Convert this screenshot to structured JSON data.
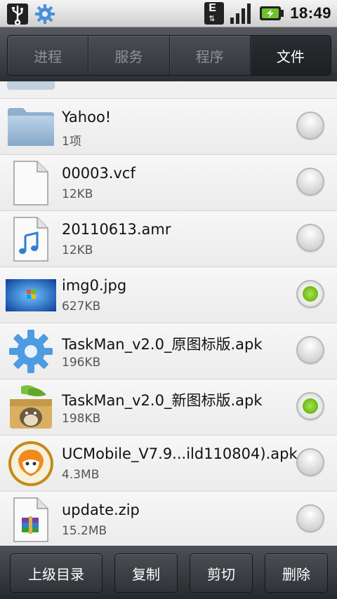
{
  "status_bar": {
    "time": "18:49",
    "left_icons": [
      "usb-icon",
      "gear-icon"
    ],
    "right_icons": [
      "edge-network-icon",
      "signal-icon",
      "battery-charging-icon"
    ],
    "network_letter": "E"
  },
  "tabs": [
    {
      "label": "进程",
      "active": false
    },
    {
      "label": "服务",
      "active": false
    },
    {
      "label": "程序",
      "active": false
    },
    {
      "label": "文件",
      "active": true
    }
  ],
  "files": [
    {
      "name": "Yahoo!",
      "info": "1项",
      "icon": "folder-icon",
      "selected": false
    },
    {
      "name": "00003.vcf",
      "info": "12KB",
      "icon": "document-icon",
      "selected": false
    },
    {
      "name": "20110613.amr",
      "info": "12KB",
      "icon": "audio-file-icon",
      "selected": false
    },
    {
      "name": "img0.jpg",
      "info": "627KB",
      "icon": "image-thumbnail-icon",
      "selected": true
    },
    {
      "name": "TaskMan_v2.0_原图标版.apk",
      "info": "196KB",
      "icon": "gear-app-icon",
      "selected": false
    },
    {
      "name": "TaskMan_v2.0_新图标版.apk",
      "info": "198KB",
      "icon": "totoro-app-icon",
      "selected": true
    },
    {
      "name": "UCMobile_V7.9...ild110804).apk",
      "info": "4.3MB",
      "icon": "ucmobile-app-icon",
      "selected": false
    },
    {
      "name": "update.zip",
      "info": "15.2MB",
      "icon": "archive-file-icon",
      "selected": false
    }
  ],
  "bottom_bar": {
    "parent_dir": "上级目录",
    "copy": "复制",
    "cut": "剪切",
    "delete": "删除"
  },
  "colors": {
    "selected_radio": "#7cc627",
    "tab_active_text": "#ffffff",
    "tab_inactive_text": "#8e9297"
  }
}
